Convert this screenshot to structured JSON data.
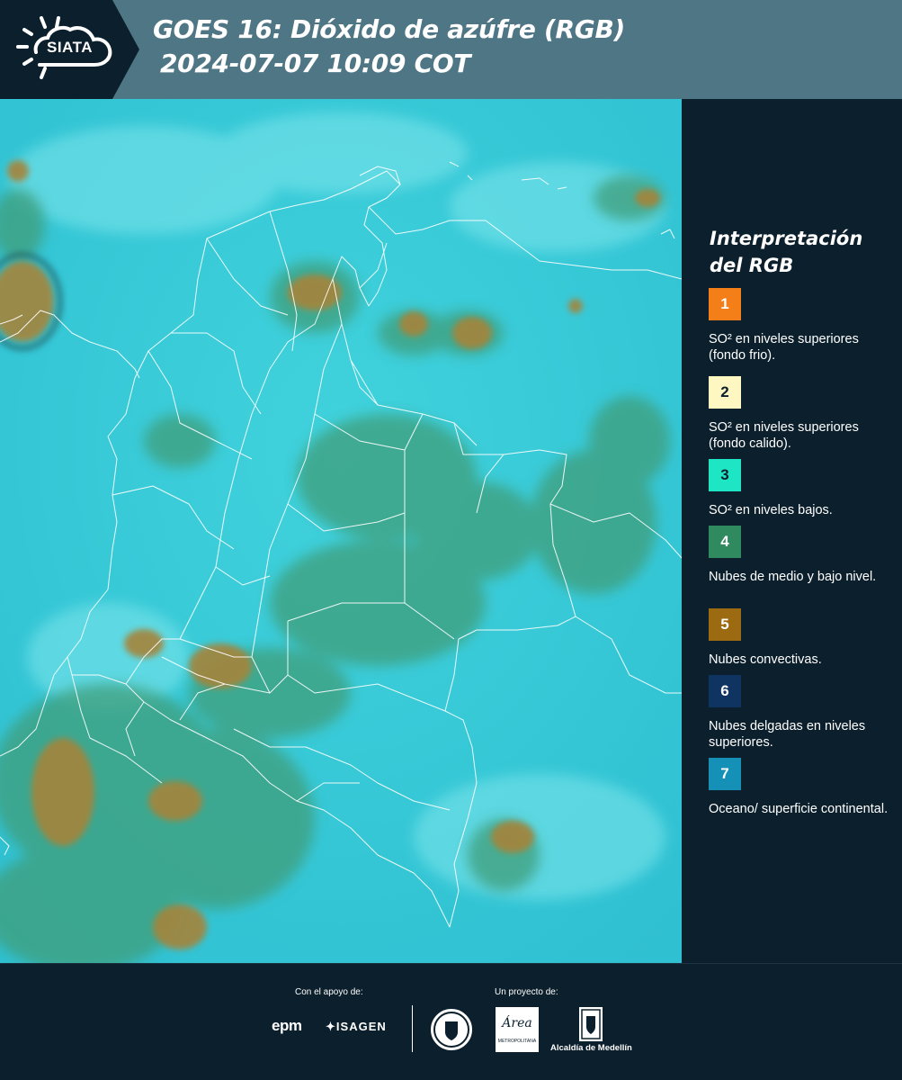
{
  "header": {
    "logo_text": "SIATA",
    "title_line1": "GOES 16: Dióxido de azúfre (RGB)",
    "title_line2": "2024-07-07 10:09 COT"
  },
  "legend": {
    "title_line1": "Interpretación",
    "title_line2": "del RGB",
    "items": [
      {
        "number": "1",
        "label": "SO² en niveles superiores (fondo frio).",
        "color": "#f47e17",
        "text_color": "#ffffff"
      },
      {
        "number": "2",
        "label": "SO² en niveles superiores (fondo calido).",
        "color": "#fef7c2",
        "text_color": "#0c1f2c"
      },
      {
        "number": "3",
        "label": "SO² en niveles bajos.",
        "color": "#1ee6c4",
        "text_color": "#0c1f2c"
      },
      {
        "number": "4",
        "label": "Nubes de medio y bajo nivel.",
        "color": "#2f8a60",
        "text_color": "#ffffff"
      },
      {
        "number": "5",
        "label": "Nubes convectivas.",
        "color": "#9c6a10",
        "text_color": "#ffffff"
      },
      {
        "number": "6",
        "label": "Nubes delgadas en niveles superiores.",
        "color": "#0f3462",
        "text_color": "#ffffff"
      },
      {
        "number": "7",
        "label": "Oceano/ superficie continental.",
        "color": "#1591b8",
        "text_color": "#ffffff"
      }
    ]
  },
  "footer": {
    "support_caption": "Con el apoyo de:",
    "project_caption": "Un proyecto de:",
    "epm": "epm",
    "isagen": "ISAGEN",
    "area": "Área",
    "area_sub": "METROPOLITANA",
    "alcaldia": "Alcaldía de Medellín"
  },
  "colors": {
    "header_bg": "#4f7684",
    "panel_bg": "#0c1f2c",
    "map_base": "#38c9d6"
  }
}
